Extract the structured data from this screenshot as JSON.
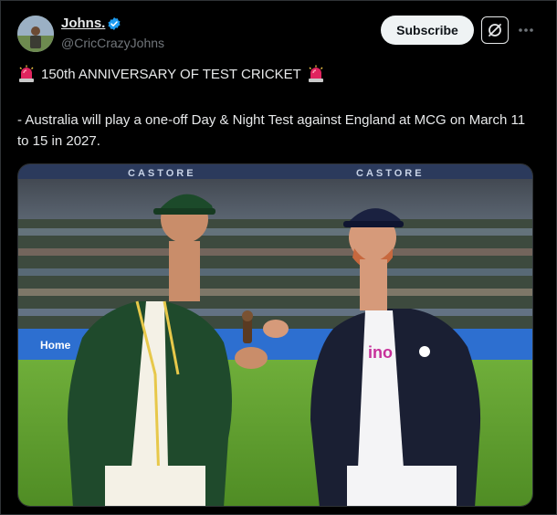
{
  "author": {
    "name": "Johns.",
    "handle": "@CricCrazyJohns"
  },
  "actions": {
    "subscribe_label": "Subscribe"
  },
  "post": {
    "headline": "150th ANNIVERSARY OF TEST CRICKET",
    "body": "- Australia will play a one-off Day & Night Test against England at MCG on March 11 to 15 in 2027."
  },
  "media": {
    "stadium_banner": "CASTORE",
    "sponsor_board": "Home",
    "shirt_sponsor": "ino"
  },
  "colors": {
    "background": "#000000",
    "text": "#e7e9ea",
    "muted": "#71767b",
    "verified": "#1d9bf0",
    "siren": "#e0245e",
    "australia_green": "#1f4a2c",
    "england_navy": "#1a1f33"
  },
  "icons": [
    "verified-badge-icon",
    "grok-icon",
    "more-icon",
    "siren-icon"
  ]
}
